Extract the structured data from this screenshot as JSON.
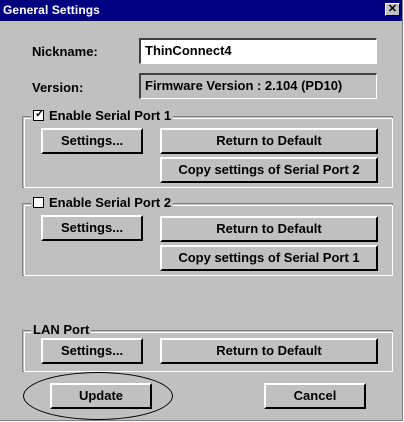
{
  "window": {
    "title": "General Settings",
    "close_glyph": "✕"
  },
  "nickname": {
    "label": "Nickname:",
    "value": "ThinConnect4"
  },
  "version": {
    "label": "Version:",
    "value": "Firmware Version : 2.104  (PD10)"
  },
  "serial1": {
    "label": "Enable Serial Port 1",
    "checked": true,
    "check_glyph": "✓",
    "settings": "Settings...",
    "default": "Return to Default",
    "copy": "Copy settings of Serial Port 2"
  },
  "serial2": {
    "label": "Enable Serial Port 2",
    "checked": false,
    "settings": "Settings...",
    "default": "Return to Default",
    "copy": "Copy settings of Serial Port 1"
  },
  "lan": {
    "label": "LAN Port",
    "settings": "Settings...",
    "default": "Return to Default"
  },
  "footer": {
    "update": "Update",
    "cancel": "Cancel"
  },
  "colors": {
    "face": "#c0c0c0",
    "titlebar": "#000080"
  },
  "icons": {
    "close": "close-icon",
    "checkbox": "checkbox-icon"
  }
}
